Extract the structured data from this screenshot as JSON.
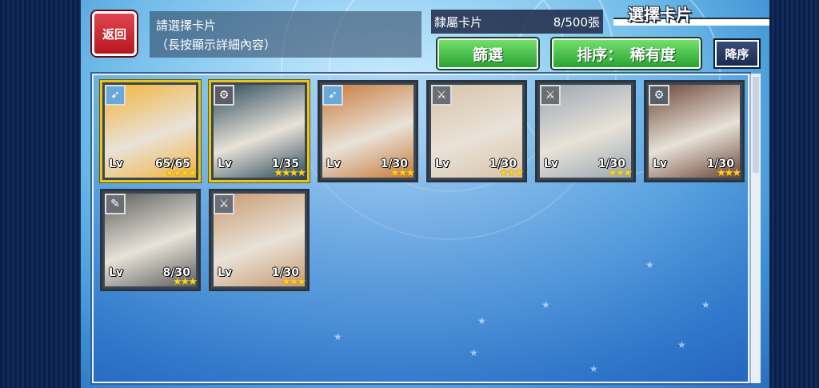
{
  "header": {
    "back_label": "返回",
    "message_line1": "請選擇卡片",
    "message_line2": "（長按顯示詳細內容）",
    "count_label": "隸屬卡片",
    "count_value": "8/500張",
    "title": "選擇卡片"
  },
  "toolbar": {
    "filter_label": "篩選",
    "sort_label": "排序：　稀有度",
    "sort_dir_label": "降序"
  },
  "cards": [
    {
      "lv_label": "Lv",
      "level": "65/65",
      "stars": "★★★★",
      "attribute": "bow-icon",
      "frame": "gold",
      "bg": "#f2b43c"
    },
    {
      "lv_label": "Lv",
      "level": "1/35",
      "stars": "★★★★",
      "attribute": "gear-icon",
      "frame": "gold",
      "bg": "#2d4b5c"
    },
    {
      "lv_label": "Lv",
      "level": "1/30",
      "stars": "★★★",
      "attribute": "bow-icon",
      "frame": "gray",
      "bg": "#c87a3a"
    },
    {
      "lv_label": "Lv",
      "level": "1/30",
      "stars": "★★★",
      "attribute": "sword-icon",
      "frame": "gray",
      "bg": "#d8c3a8"
    },
    {
      "lv_label": "Lv",
      "level": "1/30",
      "stars": "★★★",
      "attribute": "sword-icon",
      "frame": "gray",
      "bg": "#9aa6b2"
    },
    {
      "lv_label": "Lv",
      "level": "1/30",
      "stars": "★★★",
      "attribute": "gear-icon",
      "frame": "gray",
      "bg": "#6b4638"
    },
    {
      "lv_label": "Lv",
      "level": "8/30",
      "stars": "★★★",
      "attribute": "wrench-icon",
      "frame": "gray",
      "bg": "#5d5f5e"
    },
    {
      "lv_label": "Lv",
      "level": "1/30",
      "stars": "★★★",
      "attribute": "sword-icon",
      "frame": "gray",
      "bg": "#c89a70"
    }
  ],
  "colors": {
    "gold_frame": "#e5c51b",
    "green_button": "#2aa234",
    "back_button": "#b8171f"
  }
}
